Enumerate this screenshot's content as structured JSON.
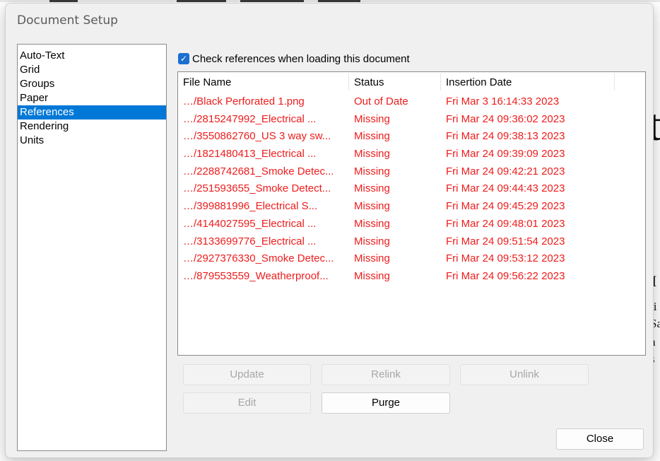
{
  "dialog": {
    "title": "Document Setup",
    "categories": [
      "Auto-Text",
      "Grid",
      "Groups",
      "Paper",
      "References",
      "Rendering",
      "Units"
    ],
    "selected_category": "References"
  },
  "references": {
    "check_label": "Check references when loading this document",
    "checked": true,
    "columns": [
      "File Name",
      "Status",
      "Insertion Date"
    ],
    "rows": [
      [
        "…/Black Perforated 1.png",
        "Out of Date",
        "Fri Mar  3 16:14:33 2023"
      ],
      [
        "…/2815247992_Electrical ...",
        "Missing",
        "Fri Mar 24 09:36:02 2023"
      ],
      [
        "…/3550862760_US 3 way sw...",
        "Missing",
        "Fri Mar 24 09:38:13 2023"
      ],
      [
        "…/1821480413_Electrical ...",
        "Missing",
        "Fri Mar 24 09:39:09 2023"
      ],
      [
        "…/2288742681_Smoke Detec...",
        "Missing",
        "Fri Mar 24 09:42:21 2023"
      ],
      [
        "…/251593655_Smoke Detect...",
        "Missing",
        "Fri Mar 24 09:44:43 2023"
      ],
      [
        "…/399881996_Electrical S...",
        "Missing",
        "Fri Mar 24 09:45:29 2023"
      ],
      [
        "…/4144027595_Electrical ...",
        "Missing",
        "Fri Mar 24 09:48:01 2023"
      ],
      [
        "…/3133699776_Electrical ...",
        "Missing",
        "Fri Mar 24 09:51:54 2023"
      ],
      [
        "…/2927376330_Smoke Detec...",
        "Missing",
        "Fri Mar 24 09:53:12 2023"
      ],
      [
        "…/879553559_Weatherproof...",
        "Missing",
        "Fri Mar 24 09:56:22 2023"
      ]
    ],
    "row_color": "#ee1c1c"
  },
  "buttons": {
    "update": "Update",
    "relink": "Relink",
    "unlink": "Unlink",
    "edit": "Edit",
    "purge": "Purge",
    "close": "Close"
  },
  "background": {
    "frag_t": "t",
    "frag_I": "I",
    "lines": [
      "li",
      "Sa",
      "a",
      "s"
    ]
  },
  "colors": {
    "selection": "#0078d7",
    "missing_text": "#ee1c1c",
    "checkbox": "#1a6fd1"
  }
}
